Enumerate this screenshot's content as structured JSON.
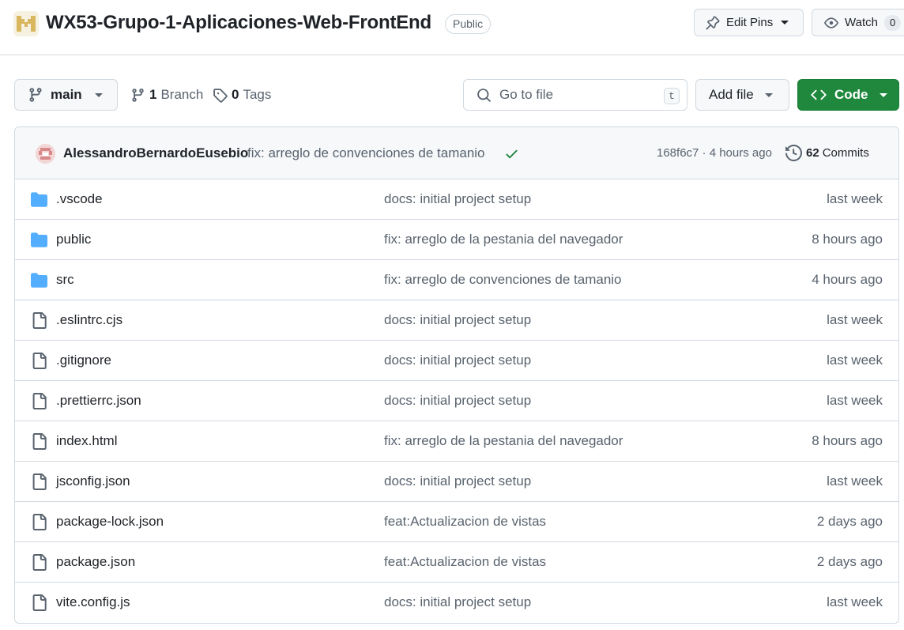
{
  "repo": {
    "name": "WX53-Grupo-1-Aplicaciones-Web-FrontEnd",
    "visibility": "Public",
    "edit_pins_label": "Edit Pins",
    "watch_label": "Watch",
    "watch_count": "0"
  },
  "toolbar": {
    "branch": "main",
    "branches_count": "1",
    "branches_label": "Branch",
    "tags_count": "0",
    "tags_label": "Tags",
    "search_placeholder": "Go to file",
    "search_shortcut": "t",
    "add_file_label": "Add file",
    "code_label": "Code"
  },
  "latest_commit": {
    "author": "AlessandroBernardoEusebio",
    "message": "fix: arreglo de convenciones de tamanio",
    "hash_time": "168f6c7 · 4 hours ago",
    "commits_count": "62",
    "commits_label": "Commits"
  },
  "files": [
    {
      "name": ".vscode",
      "type": "folder",
      "message": "docs: initial project setup",
      "time": "last week"
    },
    {
      "name": "public",
      "type": "folder",
      "message": "fix: arreglo de la pestania del navegador",
      "time": "8 hours ago"
    },
    {
      "name": "src",
      "type": "folder",
      "message": "fix: arreglo de convenciones de tamanio",
      "time": "4 hours ago"
    },
    {
      "name": ".eslintrc.cjs",
      "type": "file",
      "message": "docs: initial project setup",
      "time": "last week"
    },
    {
      "name": ".gitignore",
      "type": "file",
      "message": "docs: initial project setup",
      "time": "last week"
    },
    {
      "name": ".prettierrc.json",
      "type": "file",
      "message": "docs: initial project setup",
      "time": "last week"
    },
    {
      "name": "index.html",
      "type": "file",
      "message": "fix: arreglo de la pestania del navegador",
      "time": "8 hours ago"
    },
    {
      "name": "jsconfig.json",
      "type": "file",
      "message": "docs: initial project setup",
      "time": "last week"
    },
    {
      "name": "package-lock.json",
      "type": "file",
      "message": "feat:Actualizacion de vistas",
      "time": "2 days ago"
    },
    {
      "name": "package.json",
      "type": "file",
      "message": "feat:Actualizacion de vistas",
      "time": "2 days ago"
    },
    {
      "name": "vite.config.js",
      "type": "file",
      "message": "docs: initial project setup",
      "time": "last week"
    }
  ],
  "colors": {
    "accent_green": "#1f883d",
    "folder_blue": "#54aeff",
    "muted_text": "#59636e",
    "border": "#d1d9e0"
  },
  "icons": {
    "editpins": "pin-icon",
    "watch": "eye-icon",
    "branch": "git-branch-icon",
    "tags": "tag-icon",
    "search": "search-icon",
    "code": "code-icon",
    "commits": "history-icon",
    "status": "check-icon",
    "folder": "folder-icon",
    "file": "file-icon"
  }
}
